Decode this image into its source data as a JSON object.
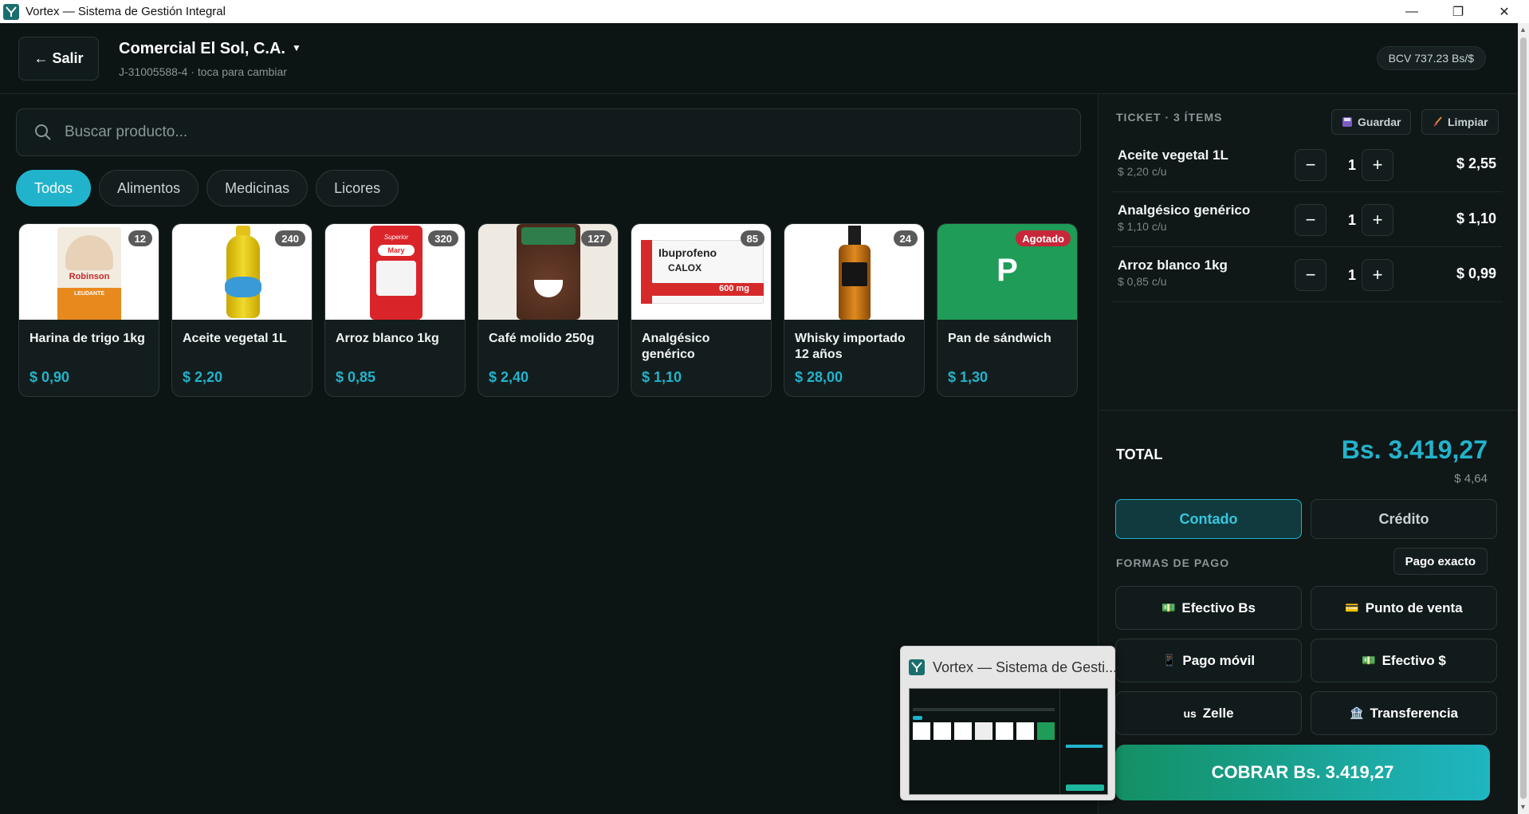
{
  "window": {
    "title": "Vortex — Sistema de Gestión Integral",
    "minimize": "—",
    "restore": "❐",
    "close": "✕"
  },
  "header": {
    "back_label": "← Salir",
    "company_name": "Comercial El Sol, C.A.",
    "company_caret": "▼",
    "company_sub": "J-31005588-4 · toca para cambiar",
    "rate": "BCV 737.23 Bs/$"
  },
  "search": {
    "placeholder": "Buscar producto..."
  },
  "categories": [
    {
      "label": "Todos",
      "active": true
    },
    {
      "label": "Alimentos"
    },
    {
      "label": "Medicinas"
    },
    {
      "label": "Licores"
    }
  ],
  "products": [
    {
      "name": "Harina de trigo 1kg",
      "price": "$ 0,90",
      "stock": "12",
      "brand": "Robinson",
      "sub": "LEUDANTE"
    },
    {
      "name": "Aceite vegetal 1L",
      "price": "$ 2,20",
      "stock": "240",
      "brand": ""
    },
    {
      "name": "Arroz blanco 1kg",
      "price": "$ 0,85",
      "stock": "320",
      "brand": "Mary",
      "sub": "Superior"
    },
    {
      "name": "Café molido 250g",
      "price": "$ 2,40",
      "stock": "127"
    },
    {
      "name": "Analgésico genérico",
      "price": "$ 1,10",
      "stock": "85",
      "brand": "Ibuprofeno",
      "sub": "CALOX",
      "dose": "600 mg"
    },
    {
      "name": "Whisky importado 12 años",
      "price": "$ 28,00",
      "stock": "24"
    },
    {
      "name": "Pan de sándwich",
      "price": "$ 1,30",
      "stock": "Agotado",
      "letter": "P"
    }
  ],
  "ticket": {
    "header": "TICKET · 3 ÍTEMS",
    "save_label": "Guardar",
    "clear_label": "Limpiar",
    "minus": "−",
    "plus": "+",
    "lines": [
      {
        "name": "Aceite vegetal 1L",
        "unit": "$ 2,20 c/u",
        "qty": "1",
        "total": "$ 2,55"
      },
      {
        "name": "Analgésico genérico",
        "unit": "$ 1,10 c/u",
        "qty": "1",
        "total": "$ 1,10"
      },
      {
        "name": "Arroz blanco 1kg",
        "unit": "$ 0,85 c/u",
        "qty": "1",
        "total": "$ 0,99"
      }
    ],
    "total_label": "TOTAL",
    "total_bs": "Bs. 3.419,27",
    "total_usd": "$ 4,64",
    "mode_cash": "Contado",
    "mode_credit": "Crédito",
    "payment_label": "FORMAS DE PAGO",
    "exact_label": "Pago exacto",
    "payments": [
      {
        "label": "Efectivo Bs",
        "icon": "💵"
      },
      {
        "label": "Punto de venta",
        "icon": "💳"
      },
      {
        "label": "Pago móvil",
        "icon": "📱"
      },
      {
        "label": "Efectivo $",
        "icon": "💵"
      },
      {
        "label": "Zelle",
        "icon": "us"
      },
      {
        "label": "Transferencia",
        "icon": "🏦"
      }
    ],
    "charge_label": "COBRAR Bs. 3.419,27"
  },
  "preview": {
    "title": "Vortex — Sistema de Gesti..."
  },
  "colors": {
    "accent": "#22b3cc",
    "sold_out": "#c8263a",
    "green": "#138f63",
    "background": "#0d1414"
  }
}
